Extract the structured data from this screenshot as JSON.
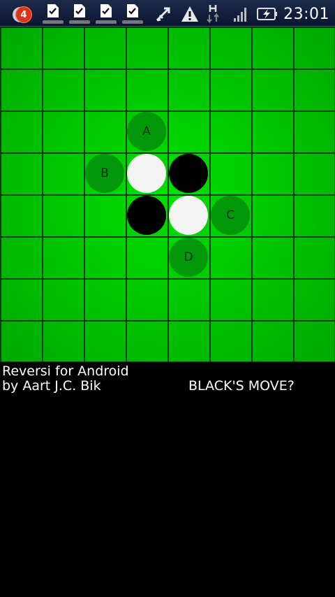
{
  "status_bar": {
    "notification_count": "4",
    "clock": "23:01",
    "icons": [
      "notification-bubble-icon",
      "download-complete-icon",
      "download-complete-icon",
      "download-complete-icon",
      "download-complete-icon",
      "usb-debug-icon",
      "warning-icon",
      "hsdpa-data-icon",
      "signal-strength-icon",
      "battery-charging-icon"
    ]
  },
  "board": {
    "size": 8,
    "colors": {
      "board": "#00c800",
      "grid": "#063a06",
      "white": "#f4f4f4",
      "black": "#000000",
      "hint": "#02980a"
    },
    "discs": [
      {
        "row": 3,
        "col": 3,
        "color": "white"
      },
      {
        "row": 3,
        "col": 4,
        "color": "black"
      },
      {
        "row": 4,
        "col": 3,
        "color": "black"
      },
      {
        "row": 4,
        "col": 4,
        "color": "white"
      }
    ],
    "hints": [
      {
        "row": 2,
        "col": 3,
        "label": "A"
      },
      {
        "row": 3,
        "col": 2,
        "label": "B"
      },
      {
        "row": 4,
        "col": 5,
        "label": "C"
      },
      {
        "row": 5,
        "col": 4,
        "label": "D"
      }
    ]
  },
  "info": {
    "title": "Reversi for Android",
    "author": "by Aart J.C. Bik",
    "turn": "BLACK'S MOVE?"
  }
}
